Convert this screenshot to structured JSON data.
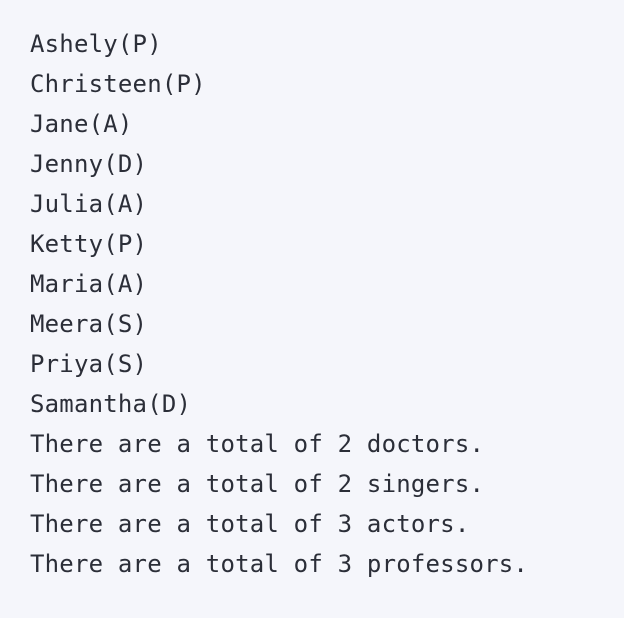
{
  "output": {
    "names": [
      "Ashely(P)",
      "Christeen(P)",
      "Jane(A)",
      "Jenny(D)",
      "Julia(A)",
      "Ketty(P)",
      "Maria(A)",
      "Meera(S)",
      "Priya(S)",
      "Samantha(D)"
    ],
    "totals": [
      "There are a total of 2 doctors.",
      "There are a total of 2 singers.",
      "There are a total of 3 actors.",
      "There are a total of 3 professors."
    ]
  }
}
